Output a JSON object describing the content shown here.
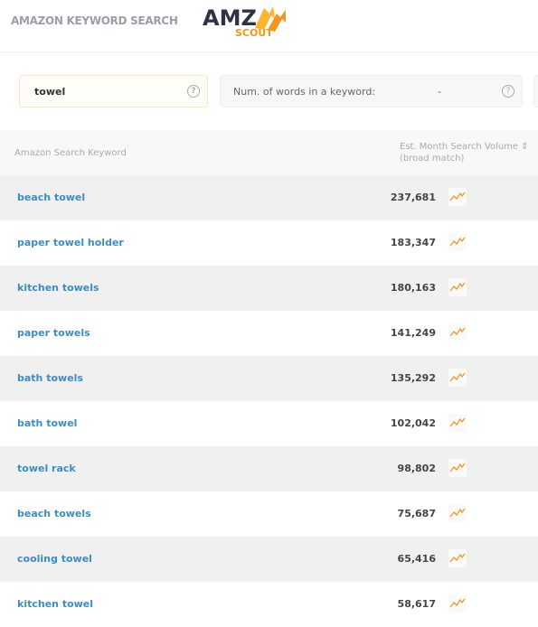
{
  "header": {
    "title": "AMAZON KEYWORD SEARCH",
    "logo": "AMZ SCOUT"
  },
  "filters": {
    "keyword": "towel",
    "num_words_label": "Num. of words in a keyword:",
    "num_words_value": "-",
    "help": "?"
  },
  "table": {
    "columns": [
      "Amazon Search Keyword",
      "Est. Month Search Volume ⇕",
      "(broad match)"
    ],
    "rows": [
      {
        "keyword": "beach towel",
        "volume": "237,681"
      },
      {
        "keyword": "paper towel holder",
        "volume": "183,347"
      },
      {
        "keyword": "kitchen towels",
        "volume": "180,163"
      },
      {
        "keyword": "paper towels",
        "volume": "141,249"
      },
      {
        "keyword": "bath towels",
        "volume": "135,292"
      },
      {
        "keyword": "bath towel",
        "volume": "102,042"
      },
      {
        "keyword": "towel rack",
        "volume": "98,802"
      },
      {
        "keyword": "beach towels",
        "volume": "75,687"
      },
      {
        "keyword": "cooling towel",
        "volume": "65,416"
      },
      {
        "keyword": "kitchen towel",
        "volume": "58,617"
      }
    ]
  },
  "colors": {
    "link": "#3b8dc4",
    "accent": "#f7941d"
  }
}
